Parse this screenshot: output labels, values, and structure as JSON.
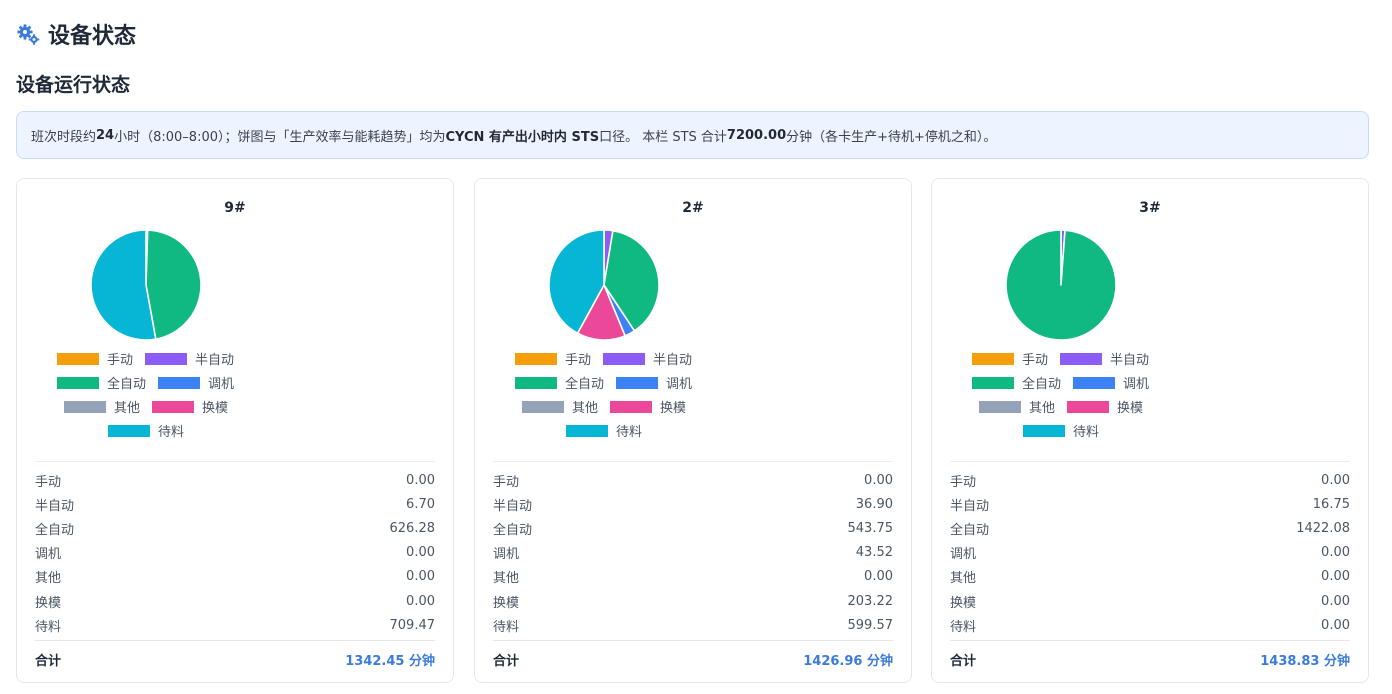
{
  "page": {
    "title": "设备状态",
    "section_title": "设备运行状态"
  },
  "info": {
    "t1": "班次时段约 ",
    "b1": "24",
    "t2": " 小时（8:00–8:00）；饼图与「生产效率与能耗趋势」均为 ",
    "b2": "CYCN 有产出小时内 STS",
    "t3": " 口径。 本栏 STS 合计 ",
    "b3": "7200.00",
    "t4": " 分钟（各卡生产+待机+停机之和）。"
  },
  "categories": [
    {
      "label": "手动",
      "color": "#f59e0b"
    },
    {
      "label": "半自动",
      "color": "#8b5cf6"
    },
    {
      "label": "全自动",
      "color": "#10b981"
    },
    {
      "label": "调机",
      "color": "#3b82f6"
    },
    {
      "label": "其他",
      "color": "#94a3b8"
    },
    {
      "label": "换模",
      "color": "#ec4899"
    },
    {
      "label": "待料",
      "color": "#06b6d4"
    }
  ],
  "total_label": "合计",
  "unit": "分钟",
  "chart_data": [
    {
      "type": "pie",
      "title": "9#",
      "categories": [
        "手动",
        "半自动",
        "全自动",
        "调机",
        "其他",
        "换模",
        "待料"
      ],
      "values": [
        0.0,
        6.7,
        626.28,
        0.0,
        0.0,
        0.0,
        709.47
      ]
    },
    {
      "type": "pie",
      "title": "2#",
      "categories": [
        "手动",
        "半自动",
        "全自动",
        "调机",
        "其他",
        "换模",
        "待料"
      ],
      "values": [
        0.0,
        36.9,
        543.75,
        43.52,
        0.0,
        203.22,
        599.57
      ]
    },
    {
      "type": "pie",
      "title": "3#",
      "categories": [
        "手动",
        "半自动",
        "全自动",
        "调机",
        "其他",
        "换模",
        "待料"
      ],
      "values": [
        0.0,
        16.75,
        1422.08,
        0.0,
        0.0,
        0.0,
        0.0
      ]
    }
  ],
  "cards": [
    {
      "title": "9#",
      "rows": [
        {
          "label": "手动",
          "value": "0.00"
        },
        {
          "label": "半自动",
          "value": "6.70"
        },
        {
          "label": "全自动",
          "value": "626.28"
        },
        {
          "label": "调机",
          "value": "0.00"
        },
        {
          "label": "其他",
          "value": "0.00"
        },
        {
          "label": "换模",
          "value": "0.00"
        },
        {
          "label": "待料",
          "value": "709.47"
        }
      ],
      "total": "1342.45 分钟"
    },
    {
      "title": "2#",
      "rows": [
        {
          "label": "手动",
          "value": "0.00"
        },
        {
          "label": "半自动",
          "value": "36.90"
        },
        {
          "label": "全自动",
          "value": "543.75"
        },
        {
          "label": "调机",
          "value": "43.52"
        },
        {
          "label": "其他",
          "value": "0.00"
        },
        {
          "label": "换模",
          "value": "203.22"
        },
        {
          "label": "待料",
          "value": "599.57"
        }
      ],
      "total": "1426.96 分钟"
    },
    {
      "title": "3#",
      "rows": [
        {
          "label": "手动",
          "value": "0.00"
        },
        {
          "label": "半自动",
          "value": "16.75"
        },
        {
          "label": "全自动",
          "value": "1422.08"
        },
        {
          "label": "调机",
          "value": "0.00"
        },
        {
          "label": "其他",
          "value": "0.00"
        },
        {
          "label": "换模",
          "value": "0.00"
        },
        {
          "label": "待料",
          "value": "0.00"
        }
      ],
      "total": "1438.83 分钟"
    }
  ]
}
